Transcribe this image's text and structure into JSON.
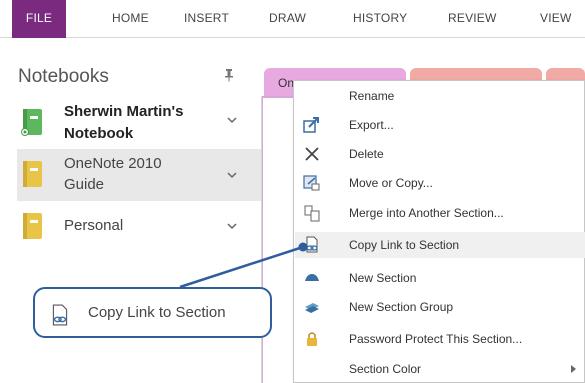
{
  "ribbon": {
    "tabs": [
      {
        "id": "file",
        "label": "FILE"
      },
      {
        "id": "home",
        "label": "HOME"
      },
      {
        "id": "insert",
        "label": "INSERT"
      },
      {
        "id": "draw",
        "label": "DRAW"
      },
      {
        "id": "history",
        "label": "HISTORY"
      },
      {
        "id": "review",
        "label": "REVIEW"
      },
      {
        "id": "view",
        "label": "VIEW"
      }
    ]
  },
  "notebooks": {
    "title": "Notebooks",
    "items": [
      {
        "line1": "Sherwin Martin's",
        "line2": "Notebook",
        "icon": "notebook-icon-green",
        "color": "#5cb85c"
      },
      {
        "line1": "OneNote 2010",
        "line2": "Guide",
        "icon": "notebook-icon-yellow",
        "color": "#e8c547"
      },
      {
        "line1": "Personal",
        "line2": "",
        "icon": "notebook-icon-yellow",
        "color": "#e8c547"
      }
    ]
  },
  "section_tabs": {
    "active_label": "One",
    "colors": [
      "#e7a9df",
      "#f2aaa4",
      "#f2aaa4"
    ]
  },
  "context_menu": {
    "items": [
      {
        "label": "Rename",
        "icon": "none"
      },
      {
        "label": "Export...",
        "icon": "export-icon"
      },
      {
        "label": "Delete",
        "icon": "delete-x-icon"
      },
      {
        "label": "Move or Copy...",
        "icon": "move-copy-icon"
      },
      {
        "label": "Merge into Another Section...",
        "icon": "merge-icon"
      },
      {
        "label": "Copy Link to Section",
        "icon": "copy-link-icon"
      },
      {
        "label": "New Section",
        "icon": "new-section-icon"
      },
      {
        "label": "New Section Group",
        "icon": "new-section-group-icon"
      },
      {
        "label": "Password Protect This Section...",
        "icon": "lock-icon"
      },
      {
        "label": "Section Color",
        "icon": "none"
      }
    ]
  },
  "callout": {
    "label": "Copy Link to Section",
    "icon": "copy-link-icon"
  },
  "colors": {
    "file_tab": "#7a2a7f",
    "callout_border": "#2f5d9e",
    "section_frame": "#d9a6d6"
  }
}
